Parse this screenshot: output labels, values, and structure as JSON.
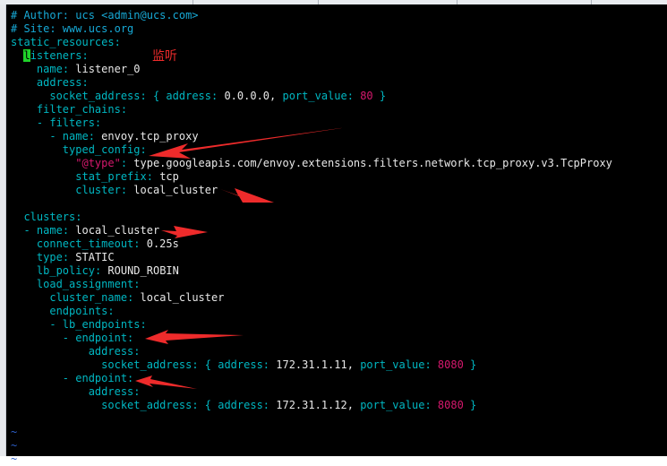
{
  "annotation_text": "监听",
  "colors": {
    "key": "#00b7c2",
    "number": "#d6186d",
    "comment": "#17a9d6",
    "tilde": "#2d5fc9",
    "cursor": "#1fd32a",
    "arrow": "#ee2b2b"
  },
  "lines": {
    "l1": "# Author: ucs <admin@ucs.com>",
    "l2": "# Site: www.ucs.org",
    "l3": "static_resources:",
    "l4a": "l",
    "l4b": "isteners:",
    "l5a": "name",
    "l5b": "listener_0",
    "l6": "address:",
    "l7a": "socket_address",
    "l7b": "address",
    "l7c": "0.0.0.0,",
    "l7d": "port_value",
    "l7e": "80",
    "l8": "filter_chains:",
    "l9": "- filters:",
    "l10a": "- name",
    "l10b": "envoy.tcp_proxy",
    "l11": "typed_config:",
    "l12a": "\"@type\"",
    "l12b": "type.googleapis.com/envoy.extensions.filters.network.tcp_proxy.v3.TcpProxy",
    "l13a": "stat_prefix",
    "l13b": "tcp",
    "l14a": "cluster",
    "l14b": "local_cluster",
    "l16": "clusters:",
    "l17a": "- name",
    "l17b": "local_cluster",
    "l18a": "connect_timeout",
    "l18b": "0.25s",
    "l19a": "type",
    "l19b": "STATIC",
    "l20a": "lb_policy",
    "l20b": "ROUND_ROBIN",
    "l21": "load_assignment:",
    "l22a": "cluster_name",
    "l22b": "local_cluster",
    "l23": "endpoints:",
    "l24": "- lb_endpoints:",
    "l25": "- endpoint:",
    "l26": "address:",
    "l27a": "socket_address",
    "l27b": "address",
    "l27c": "172.31.1.11,",
    "l27d": "port_value",
    "l27e": "8080",
    "l28": "- endpoint:",
    "l29": "address:",
    "l30a": "socket_address",
    "l30b": "address",
    "l30c": "172.31.1.12,",
    "l30d": "port_value",
    "l30e": "8080",
    "tilde": "~"
  }
}
